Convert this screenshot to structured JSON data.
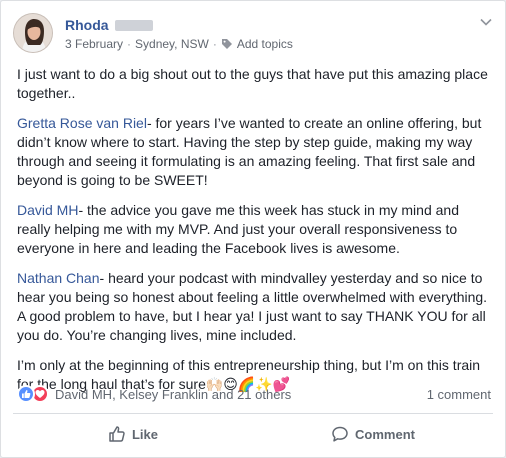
{
  "post": {
    "author": "Rhoda",
    "date": "3 February",
    "location": "Sydney, NSW",
    "add_topics": "Add topics",
    "paragraphs": [
      {
        "mention": "",
        "text": "I just want to do a big shout out to the guys that have put this amazing place together.."
      },
      {
        "mention": "Gretta Rose van Riel",
        "text": "- for years I’ve wanted to create an online offering, but didn’t know where to start. Having the step by step guide, making my way through and seeing it formulating is an amazing feeling. That first sale and beyond is going to be SWEET!"
      },
      {
        "mention": "David MH",
        "text": "- the advice you gave me this week has stuck in my mind and really helping me with my MVP. And just your overall responsiveness to everyone in here and leading the Facebook lives is awesome."
      },
      {
        "mention": "Nathan Chan",
        "text": "- heard your podcast with mindvalley yesterday and so nice to hear you being so honest about feeling a little overwhelmed with everything. A good problem to have, but I hear ya! I just want to say THANK YOU for all you do. You’re changing lives, mine included."
      },
      {
        "mention": "",
        "text": "I’m only at the beginning of this entrepreneurship thing, but I’m on this train for the long haul that’s for sure🙌🏻😊🌈✨💕"
      }
    ]
  },
  "reactions": {
    "names": "David MH, Kelsey Franklin and 21 others",
    "comments": "1 comment"
  },
  "actions": {
    "like": "Like",
    "comment": "Comment"
  },
  "colors": {
    "link": "#365899",
    "like_reaction": "#5890ff",
    "love_reaction": "#f33e58"
  }
}
